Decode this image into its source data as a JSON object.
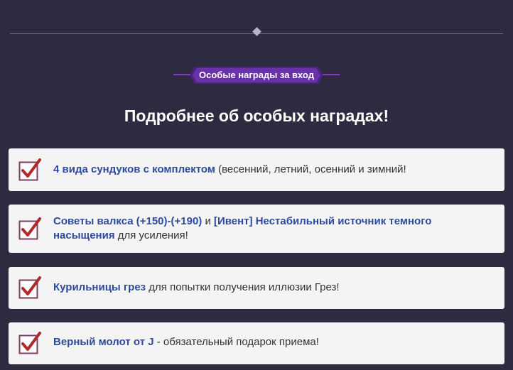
{
  "badge": {
    "label": "Особые награды за вход"
  },
  "heading": "Подробнее об особых наградах!",
  "colors": {
    "background": "#2e2a3f",
    "badge": "#6a32a8",
    "card": "#f4f4f5",
    "highlight": "#2e4a9c",
    "check": "#b02a2a"
  },
  "rewards": [
    {
      "icon": "checkmark-icon",
      "part1_highlight": "4 вида сундуков с комплектом",
      "part2": " (весенний, летний, осенний и зимний!"
    },
    {
      "icon": "checkmark-icon",
      "part1_highlight": "Советы валкса (+150)-(+190)",
      "part2": " и ",
      "part3_highlight": "[Ивент] Нестабильный источник темного насыщения",
      "part4": " для усиления!"
    },
    {
      "icon": "checkmark-icon",
      "part1_highlight": "Курильницы грез",
      "part2": " для попытки получения иллюзии Грез!"
    },
    {
      "icon": "checkmark-icon",
      "part1_highlight": "Верный молот от J",
      "part2": " - обязательный подарок приема!"
    }
  ]
}
